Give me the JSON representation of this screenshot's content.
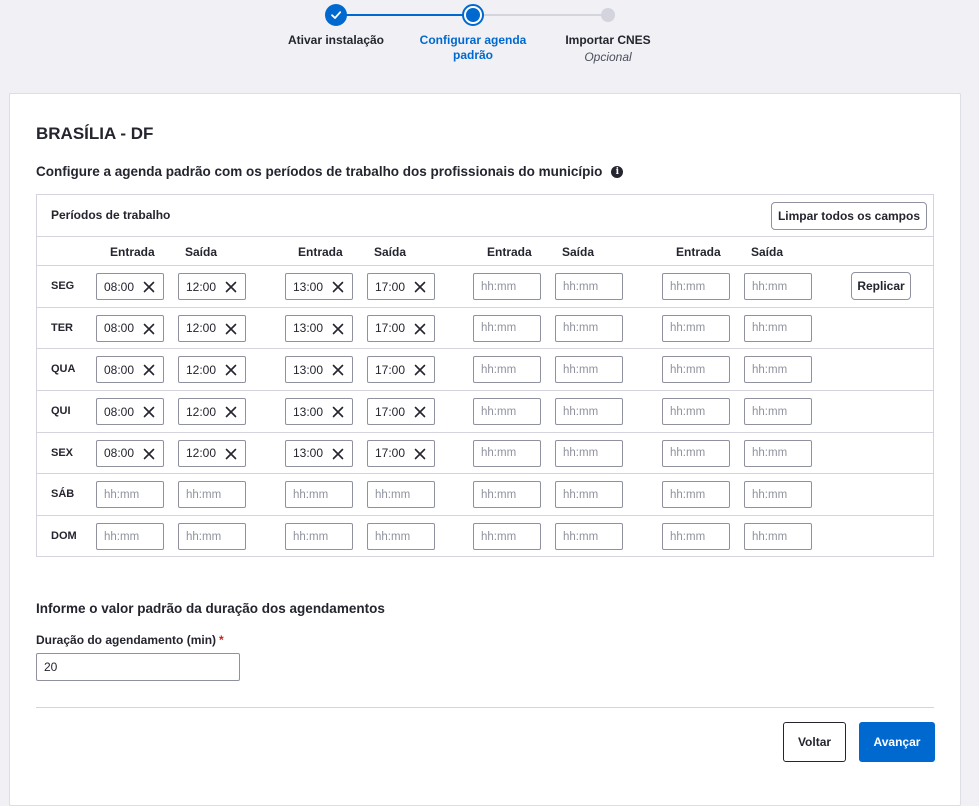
{
  "stepper": {
    "steps": [
      {
        "label": "Ativar instalação",
        "sublabel": "",
        "state": "done"
      },
      {
        "label": "Configurar agenda padrão",
        "sublabel": "",
        "state": "current"
      },
      {
        "label": "Importar CNES",
        "sublabel": "Opcional",
        "state": "pending"
      }
    ]
  },
  "card": {
    "city": "BRASÍLIA - DF",
    "config_title": "Configure a agenda padrão com os períodos de trabalho dos profissionais do município",
    "info_icon": "i"
  },
  "periods": {
    "title": "Períodos de trabalho",
    "clear_all_label": "Limpar todos os campos",
    "replicate_label": "Replicar",
    "placeholder": "hh:mm",
    "columns": [
      "Entrada",
      "Saída",
      "Entrada",
      "Saída",
      "Entrada",
      "Saída",
      "Entrada",
      "Saída"
    ],
    "rows": [
      {
        "day": "SEG",
        "values": [
          "08:00",
          "12:00",
          "13:00",
          "17:00",
          "",
          "",
          "",
          ""
        ]
      },
      {
        "day": "TER",
        "values": [
          "08:00",
          "12:00",
          "13:00",
          "17:00",
          "",
          "",
          "",
          ""
        ]
      },
      {
        "day": "QUA",
        "values": [
          "08:00",
          "12:00",
          "13:00",
          "17:00",
          "",
          "",
          "",
          ""
        ]
      },
      {
        "day": "QUI",
        "values": [
          "08:00",
          "12:00",
          "13:00",
          "17:00",
          "",
          "",
          "",
          ""
        ]
      },
      {
        "day": "SEX",
        "values": [
          "08:00",
          "12:00",
          "13:00",
          "17:00",
          "",
          "",
          "",
          ""
        ]
      },
      {
        "day": "SÁB",
        "values": [
          "",
          "",
          "",
          "",
          "",
          "",
          "",
          ""
        ]
      },
      {
        "day": "DOM",
        "values": [
          "",
          "",
          "",
          "",
          "",
          "",
          "",
          ""
        ]
      }
    ]
  },
  "duration": {
    "title": "Informe o valor padrão da duração dos agendamentos",
    "label": "Duração do agendamento (min)",
    "required_mark": "*",
    "value": "20"
  },
  "actions": {
    "back_label": "Voltar",
    "next_label": "Avançar"
  },
  "colors": {
    "primary": "#0069d0",
    "border": "#8f929e",
    "divider": "#d3d4dd",
    "required": "#d01e1e"
  }
}
